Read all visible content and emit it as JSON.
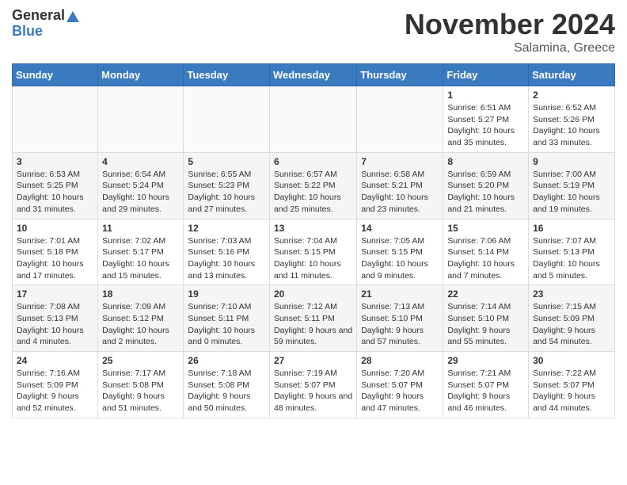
{
  "header": {
    "logo_general": "General",
    "logo_blue": "Blue",
    "month_title": "November 2024",
    "location": "Salamina, Greece"
  },
  "weekdays": [
    "Sunday",
    "Monday",
    "Tuesday",
    "Wednesday",
    "Thursday",
    "Friday",
    "Saturday"
  ],
  "weeks": [
    [
      {
        "day": "",
        "info": ""
      },
      {
        "day": "",
        "info": ""
      },
      {
        "day": "",
        "info": ""
      },
      {
        "day": "",
        "info": ""
      },
      {
        "day": "",
        "info": ""
      },
      {
        "day": "1",
        "info": "Sunrise: 6:51 AM\nSunset: 5:27 PM\nDaylight: 10 hours and 35 minutes."
      },
      {
        "day": "2",
        "info": "Sunrise: 6:52 AM\nSunset: 5:26 PM\nDaylight: 10 hours and 33 minutes."
      }
    ],
    [
      {
        "day": "3",
        "info": "Sunrise: 6:53 AM\nSunset: 5:25 PM\nDaylight: 10 hours and 31 minutes."
      },
      {
        "day": "4",
        "info": "Sunrise: 6:54 AM\nSunset: 5:24 PM\nDaylight: 10 hours and 29 minutes."
      },
      {
        "day": "5",
        "info": "Sunrise: 6:55 AM\nSunset: 5:23 PM\nDaylight: 10 hours and 27 minutes."
      },
      {
        "day": "6",
        "info": "Sunrise: 6:57 AM\nSunset: 5:22 PM\nDaylight: 10 hours and 25 minutes."
      },
      {
        "day": "7",
        "info": "Sunrise: 6:58 AM\nSunset: 5:21 PM\nDaylight: 10 hours and 23 minutes."
      },
      {
        "day": "8",
        "info": "Sunrise: 6:59 AM\nSunset: 5:20 PM\nDaylight: 10 hours and 21 minutes."
      },
      {
        "day": "9",
        "info": "Sunrise: 7:00 AM\nSunset: 5:19 PM\nDaylight: 10 hours and 19 minutes."
      }
    ],
    [
      {
        "day": "10",
        "info": "Sunrise: 7:01 AM\nSunset: 5:18 PM\nDaylight: 10 hours and 17 minutes."
      },
      {
        "day": "11",
        "info": "Sunrise: 7:02 AM\nSunset: 5:17 PM\nDaylight: 10 hours and 15 minutes."
      },
      {
        "day": "12",
        "info": "Sunrise: 7:03 AM\nSunset: 5:16 PM\nDaylight: 10 hours and 13 minutes."
      },
      {
        "day": "13",
        "info": "Sunrise: 7:04 AM\nSunset: 5:15 PM\nDaylight: 10 hours and 11 minutes."
      },
      {
        "day": "14",
        "info": "Sunrise: 7:05 AM\nSunset: 5:15 PM\nDaylight: 10 hours and 9 minutes."
      },
      {
        "day": "15",
        "info": "Sunrise: 7:06 AM\nSunset: 5:14 PM\nDaylight: 10 hours and 7 minutes."
      },
      {
        "day": "16",
        "info": "Sunrise: 7:07 AM\nSunset: 5:13 PM\nDaylight: 10 hours and 5 minutes."
      }
    ],
    [
      {
        "day": "17",
        "info": "Sunrise: 7:08 AM\nSunset: 5:13 PM\nDaylight: 10 hours and 4 minutes."
      },
      {
        "day": "18",
        "info": "Sunrise: 7:09 AM\nSunset: 5:12 PM\nDaylight: 10 hours and 2 minutes."
      },
      {
        "day": "19",
        "info": "Sunrise: 7:10 AM\nSunset: 5:11 PM\nDaylight: 10 hours and 0 minutes."
      },
      {
        "day": "20",
        "info": "Sunrise: 7:12 AM\nSunset: 5:11 PM\nDaylight: 9 hours and 59 minutes."
      },
      {
        "day": "21",
        "info": "Sunrise: 7:13 AM\nSunset: 5:10 PM\nDaylight: 9 hours and 57 minutes."
      },
      {
        "day": "22",
        "info": "Sunrise: 7:14 AM\nSunset: 5:10 PM\nDaylight: 9 hours and 55 minutes."
      },
      {
        "day": "23",
        "info": "Sunrise: 7:15 AM\nSunset: 5:09 PM\nDaylight: 9 hours and 54 minutes."
      }
    ],
    [
      {
        "day": "24",
        "info": "Sunrise: 7:16 AM\nSunset: 5:09 PM\nDaylight: 9 hours and 52 minutes."
      },
      {
        "day": "25",
        "info": "Sunrise: 7:17 AM\nSunset: 5:08 PM\nDaylight: 9 hours and 51 minutes."
      },
      {
        "day": "26",
        "info": "Sunrise: 7:18 AM\nSunset: 5:08 PM\nDaylight: 9 hours and 50 minutes."
      },
      {
        "day": "27",
        "info": "Sunrise: 7:19 AM\nSunset: 5:07 PM\nDaylight: 9 hours and 48 minutes."
      },
      {
        "day": "28",
        "info": "Sunrise: 7:20 AM\nSunset: 5:07 PM\nDaylight: 9 hours and 47 minutes."
      },
      {
        "day": "29",
        "info": "Sunrise: 7:21 AM\nSunset: 5:07 PM\nDaylight: 9 hours and 46 minutes."
      },
      {
        "day": "30",
        "info": "Sunrise: 7:22 AM\nSunset: 5:07 PM\nDaylight: 9 hours and 44 minutes."
      }
    ]
  ]
}
